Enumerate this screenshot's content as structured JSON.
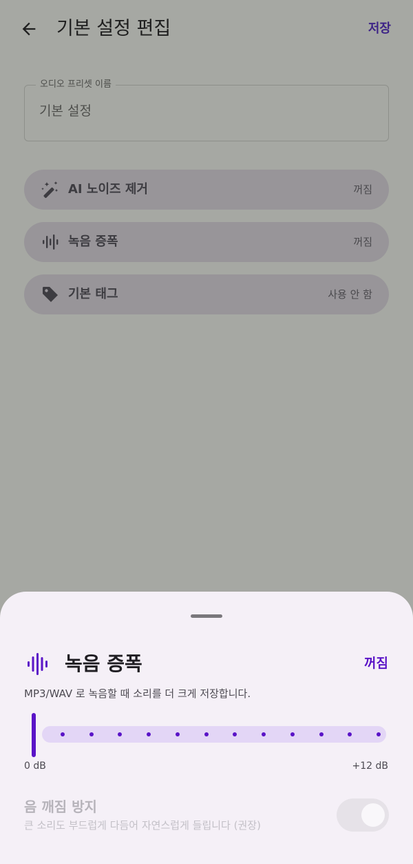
{
  "header": {
    "title": "기본 설정 편집",
    "save_label": "저장"
  },
  "preset_name": {
    "label": "오디오 프리셋 이름",
    "value": "기본 설정"
  },
  "settings": [
    {
      "icon": "magic-wand-icon",
      "label": "AI 노이즈 제거",
      "value": "꺼짐"
    },
    {
      "icon": "waveform-icon",
      "label": "녹음 증폭",
      "value": "꺼짐"
    },
    {
      "icon": "tag-icon",
      "label": "기본 태그",
      "value": "사용 안 함"
    }
  ],
  "sheet": {
    "icon": "waveform-icon",
    "title": "녹음 증폭",
    "status": "꺼짐",
    "description": "MP3/WAV 로 녹음할 때 소리를 더 크게 저장합니다.",
    "slider": {
      "min_label": "0 dB",
      "max_label": "+12 dB",
      "value_db": 0,
      "max_db": 12,
      "steps": 12
    },
    "clip_prevention": {
      "title": "음 깨짐 방지",
      "description": "큰 소리도 부드럽게 다듬어 자연스럽게 들립니다 (권장)",
      "enabled": true,
      "disabled_state": true
    }
  },
  "colors": {
    "accent": "#5a14c7",
    "scrim": "#a6a8a3",
    "sheet_bg": "#f5f0f7",
    "track": "#e3d6f6"
  }
}
